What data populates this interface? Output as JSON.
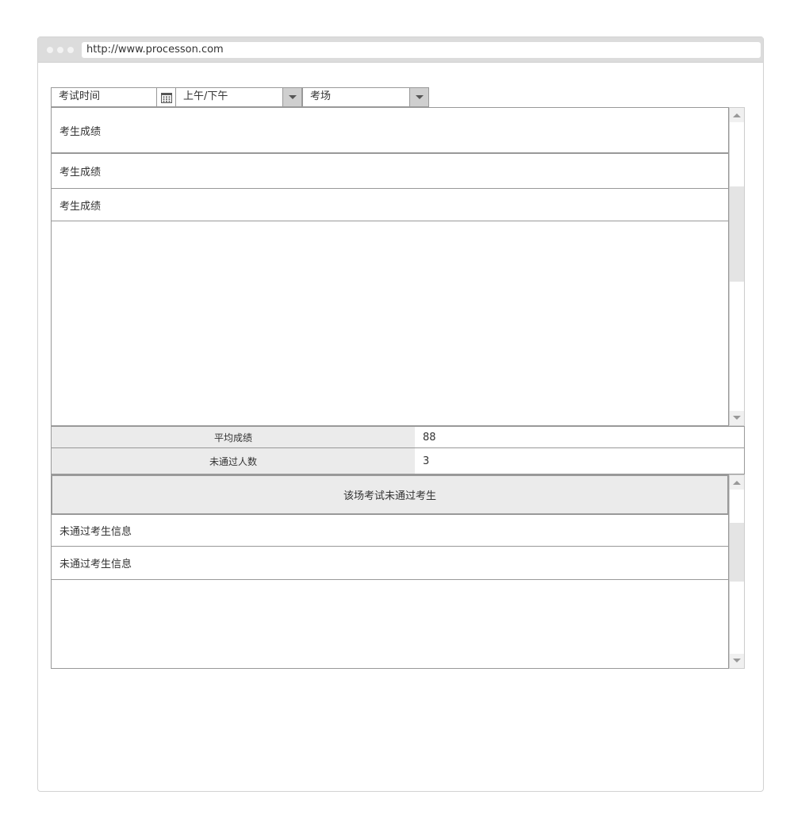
{
  "browser": {
    "url": "http://www.processon.com"
  },
  "filters": {
    "exam_time_label": "考试时间",
    "period_value": "上午/下午",
    "exam_room_value": "考场"
  },
  "scores_list": {
    "items": [
      {
        "label": "考生成绩"
      },
      {
        "label": "考生成绩"
      },
      {
        "label": "考生成绩"
      }
    ]
  },
  "stats": {
    "average_label": "平均成绩",
    "average_value": "88",
    "failed_count_label": "未通过人数",
    "failed_count_value": "3"
  },
  "failed_section": {
    "title": "该场考试未通过考生",
    "items": [
      {
        "label": "未通过考生信息"
      },
      {
        "label": "未通过考生信息"
      }
    ]
  }
}
